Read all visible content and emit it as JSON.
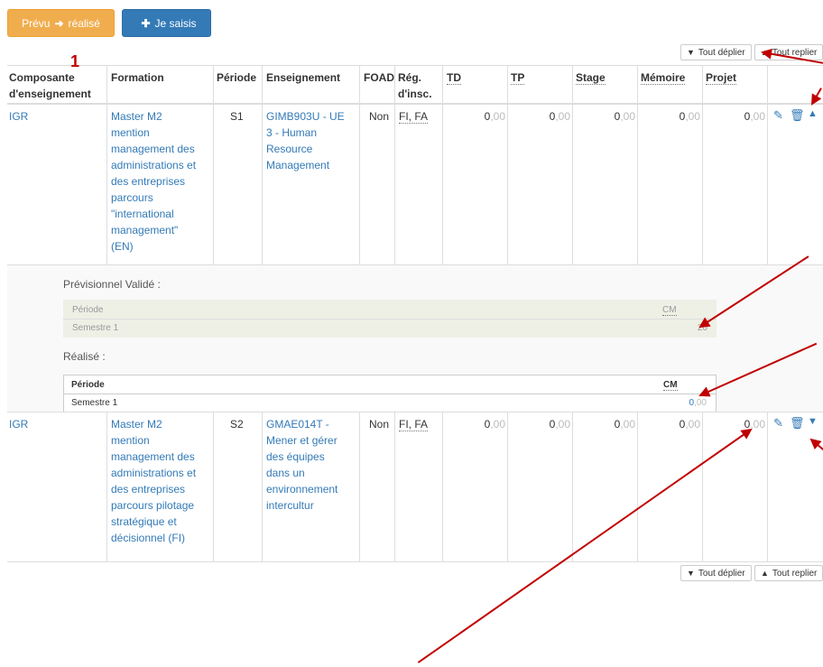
{
  "toolbar": {
    "prevu_label": "Prévu",
    "realise_label": "réalisé",
    "saisis_label": "Je saisis"
  },
  "controls": {
    "expand_all": "Tout déplier",
    "collapse_all": "Tout replier"
  },
  "marker": "1",
  "headers": {
    "composante_1": "Composante",
    "composante_2": "d'enseignement",
    "formation": "Formation",
    "periode": "Période",
    "enseignement": "Enseignement",
    "foad": "FOAD",
    "reg_1": "Rég.",
    "reg_2": "d'insc.",
    "td": "TD",
    "tp": "TP",
    "stage": "Stage",
    "memoire": "Mémoire",
    "projet": "Projet"
  },
  "rows": [
    {
      "composante": "IGR",
      "formation_lines": [
        "Master M2",
        "mention",
        "management des",
        "administrations et",
        "des entreprises",
        "parcours",
        "\"international",
        "management\"",
        "(EN)"
      ],
      "periode": "S1",
      "enseignement_lines": [
        "GIMB903U - UE",
        "3 - Human",
        "Resource",
        "Management"
      ],
      "foad": "Non",
      "reg": "FI, FA",
      "td": "0",
      "tp": "0",
      "stage": "0",
      "memoire": "0",
      "projet": "0",
      "decimals": ",00"
    },
    {
      "composante": "IGR",
      "formation_lines": [
        "Master M2",
        "mention",
        "management des",
        "administrations et",
        "des entreprises",
        "parcours pilotage",
        "stratégique et",
        "décisionnel (FI)"
      ],
      "periode": "S2",
      "enseignement_lines": [
        "GMAE014T -",
        "Mener et gérer",
        "des équipes",
        "dans un",
        "environnement",
        "intercultur"
      ],
      "foad": "Non",
      "reg": "FI, FA",
      "td": "0",
      "tp": "0",
      "stage": "0",
      "memoire": "0",
      "projet": "0",
      "decimals": ",00"
    }
  ],
  "detail": {
    "previsionnel_label": "Prévisionnel Validé :",
    "realise_label": "Réalisé :",
    "col_periode": "Période",
    "col_cm": "CM",
    "prev_semestre": "Semestre 1",
    "prev_value": "20",
    "real_semestre": "Semestre 1",
    "real_value": "0",
    "real_dec": ",00"
  },
  "colors": {
    "accent_orange": "#f0ad4e",
    "accent_blue": "#337ab7",
    "annotation_red": "#c00000"
  },
  "icons": [
    "arrow-right-icon",
    "plus-icon",
    "chevron-down-icon",
    "chevron-up-icon",
    "pencil-icon",
    "trash-icon"
  ]
}
